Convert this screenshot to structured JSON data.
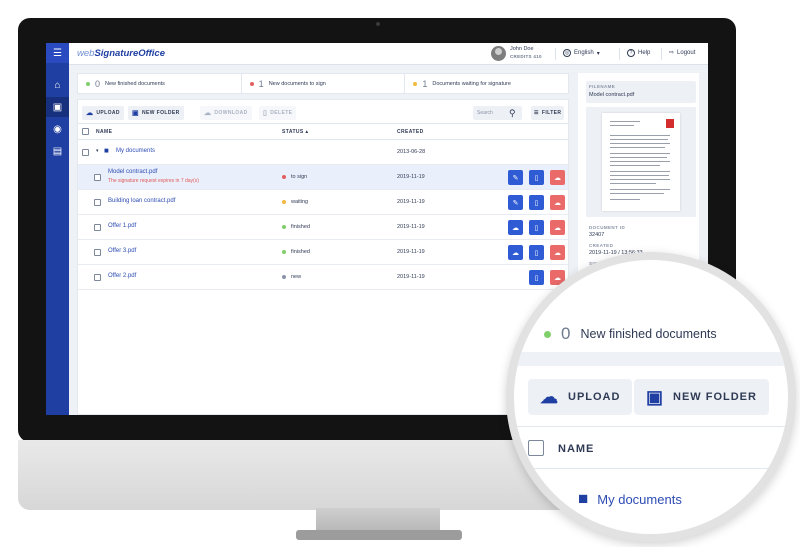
{
  "app": {
    "logo_prefix": "web",
    "logo_main": "SignatureOffice"
  },
  "user": {
    "name": "John Doe",
    "credits": "CREDITS 410"
  },
  "topnav": {
    "language": "English",
    "help": "Help",
    "logout": "Logout"
  },
  "sidebar": {
    "items": [
      "menu-icon",
      "home-icon",
      "desktop-icon",
      "signature-icon",
      "archive-icon"
    ]
  },
  "stats": [
    {
      "count": "0",
      "label": "New finished documents",
      "color": "#7fcf6a"
    },
    {
      "count": "1",
      "label": "New documents to sign",
      "color": "#e25f5f"
    },
    {
      "count": "1",
      "label": "Documents waiting for signature",
      "color": "#f4b840"
    }
  ],
  "toolbar": {
    "upload": "UPLOAD",
    "new_folder": "NEW FOLDER",
    "download": "DOWNLOAD",
    "delete": "DELETE",
    "search_placeholder": "Search",
    "filter": "FILTER"
  },
  "table": {
    "headers": {
      "name": "NAME",
      "status": "STATUS",
      "created": "CREATED"
    },
    "folder": {
      "name": "My documents",
      "created": "2013-06-28"
    },
    "rows": [
      {
        "name": "Model contract.pdf",
        "warning": "The signature request expires in 7 day(s)",
        "status": "to sign",
        "status_color": "#e25f5f",
        "created": "2019-11-19"
      },
      {
        "name": "Building loan contract.pdf",
        "status": "waiting",
        "status_color": "#f4b840",
        "created": "2019-11-19"
      },
      {
        "name": "Offer 1.pdf",
        "status": "finished",
        "status_color": "#7fcf6a",
        "created": "2019-11-19"
      },
      {
        "name": "Offer 3.pdf",
        "status": "finished",
        "status_color": "#7fcf6a",
        "created": "2019-11-19"
      },
      {
        "name": "Offer 2.pdf",
        "status": "new",
        "status_color": "#8a93a6",
        "created": "2019-11-19"
      }
    ]
  },
  "preview": {
    "filename_label": "FILENAME",
    "filename": "Model contract.pdf",
    "document_id_label": "DOCUMENT ID",
    "document_id": "32407",
    "created_label": "CREATED",
    "created": "2019-11-19 / 13:56:33",
    "signed_by_label": "SIGNED BY"
  },
  "magnifier": {
    "stat_count": "0",
    "stat_label": "New finished documents",
    "upload": "UPLOAD",
    "new_folder": "NEW FOLDER",
    "name_header": "NAME",
    "folder": "My documents"
  },
  "colors": {
    "brand": "#1f3fa3",
    "accent": "#2f5bd4",
    "danger": "#ea6a6a"
  }
}
